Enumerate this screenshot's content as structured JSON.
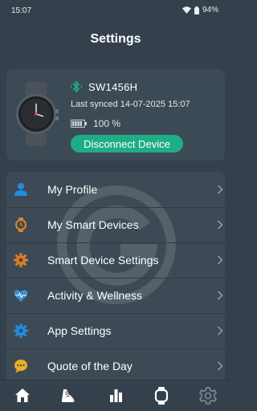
{
  "status_bar": {
    "time": "15:07",
    "battery": "94%"
  },
  "header": {
    "title": "Settings"
  },
  "device": {
    "name": "SW1456H",
    "last_synced": "Last synced 14-07-2025 15:07",
    "battery_percent": "100 %",
    "disconnect_label": "Disconnect Device"
  },
  "menu": [
    {
      "label": "My Profile",
      "icon": "person-icon",
      "color": "#1f8fe0"
    },
    {
      "label": "My Smart Devices",
      "icon": "watch-icon",
      "color": "#e0822b"
    },
    {
      "label": "Smart Device Settings",
      "icon": "gear-icon",
      "color": "#e07d22"
    },
    {
      "label": "Activity & Wellness",
      "icon": "heart-pulse-icon",
      "color": "#3d8fd6"
    },
    {
      "label": "App Settings",
      "icon": "gear-icon",
      "color": "#1f8fe0"
    },
    {
      "label": "Quote of the Day",
      "icon": "chat-bubble-icon",
      "color": "#e5b21f"
    }
  ],
  "bottom_nav": [
    "home-icon",
    "running-shoe-icon",
    "bar-chart-icon",
    "watch-icon",
    "gear-icon"
  ],
  "colors": {
    "background": "#34414c",
    "card": "#3c4a56",
    "accent_green": "#1fad86",
    "bluetooth": "#1fad86"
  }
}
